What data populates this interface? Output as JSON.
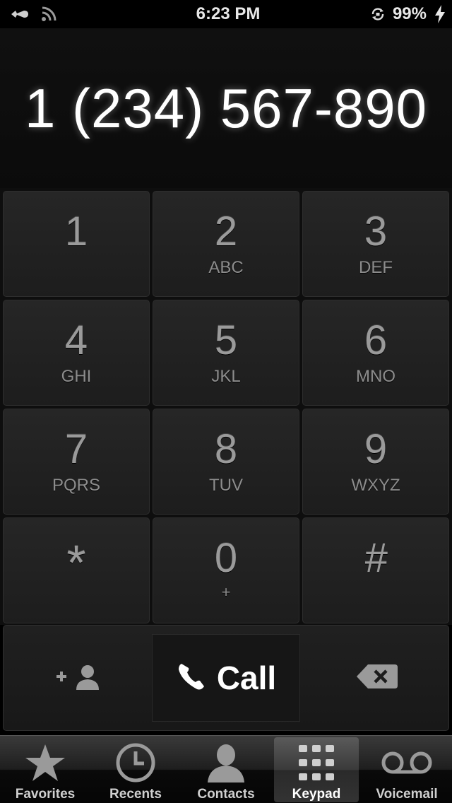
{
  "status_bar": {
    "time": "6:23 PM",
    "battery": "99%",
    "icons": [
      "carrier-icon",
      "wifi-icon",
      "rotation-lock-icon",
      "charging-icon"
    ]
  },
  "display": {
    "number": "1 (234) 567-890"
  },
  "keypad": {
    "keys": [
      {
        "digit": "1",
        "letters": ""
      },
      {
        "digit": "2",
        "letters": "ABC"
      },
      {
        "digit": "3",
        "letters": "DEF"
      },
      {
        "digit": "4",
        "letters": "GHI"
      },
      {
        "digit": "5",
        "letters": "JKL"
      },
      {
        "digit": "6",
        "letters": "MNO"
      },
      {
        "digit": "7",
        "letters": "PQRS"
      },
      {
        "digit": "8",
        "letters": "TUV"
      },
      {
        "digit": "9",
        "letters": "WXYZ"
      },
      {
        "digit": "*",
        "letters": ""
      },
      {
        "digit": "0",
        "letters": "+"
      },
      {
        "digit": "#",
        "letters": ""
      }
    ]
  },
  "actions": {
    "add_contact_icon": "add-contact-icon",
    "call_label": "Call",
    "delete_icon": "backspace-icon"
  },
  "tabs": [
    {
      "label": "Favorites",
      "icon": "star-icon",
      "selected": false
    },
    {
      "label": "Recents",
      "icon": "clock-icon",
      "selected": false
    },
    {
      "label": "Contacts",
      "icon": "person-icon",
      "selected": false
    },
    {
      "label": "Keypad",
      "icon": "keypad-icon",
      "selected": true
    },
    {
      "label": "Voicemail",
      "icon": "voicemail-icon",
      "selected": false
    }
  ],
  "colors": {
    "background": "#000000",
    "key_face": "#232323",
    "digit_text": "#9a9a9a",
    "display_text": "#ffffff"
  }
}
